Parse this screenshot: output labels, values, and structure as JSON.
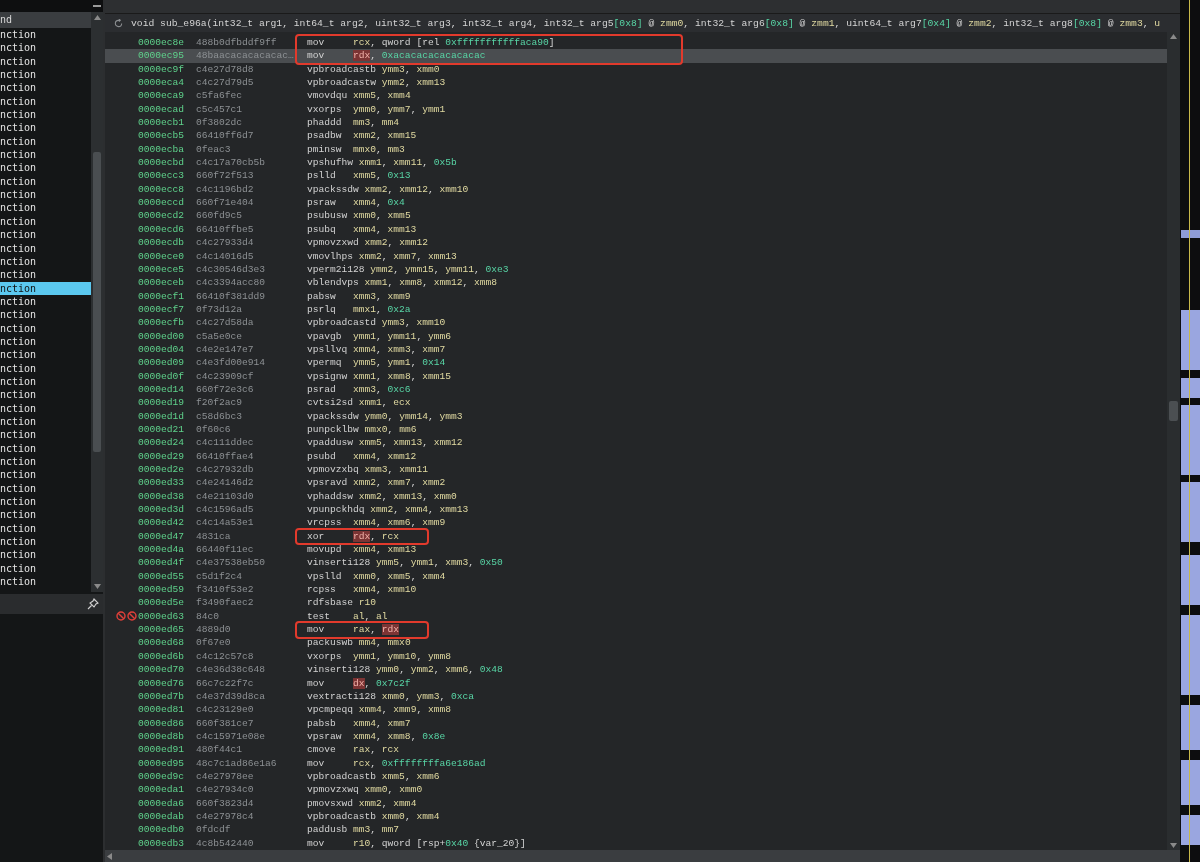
{
  "sidebar": {
    "header": "nd",
    "items": [
      {
        "label": "nction",
        "selected": false
      },
      {
        "label": "nction",
        "selected": false
      },
      {
        "label": "nction",
        "selected": false
      },
      {
        "label": "nction",
        "selected": false
      },
      {
        "label": "nction",
        "selected": false
      },
      {
        "label": "nction",
        "selected": false
      },
      {
        "label": "nction",
        "selected": false
      },
      {
        "label": "nction",
        "selected": false
      },
      {
        "label": "nction",
        "selected": false
      },
      {
        "label": "nction",
        "selected": false
      },
      {
        "label": "nction",
        "selected": false
      },
      {
        "label": "nction",
        "selected": false
      },
      {
        "label": "nction",
        "selected": false
      },
      {
        "label": "nction",
        "selected": false
      },
      {
        "label": "nction",
        "selected": false
      },
      {
        "label": "nction",
        "selected": false
      },
      {
        "label": "nction",
        "selected": false
      },
      {
        "label": "nction",
        "selected": false
      },
      {
        "label": "nction",
        "selected": false
      },
      {
        "label": "nction",
        "selected": true
      },
      {
        "label": "nction",
        "selected": false
      },
      {
        "label": "nction",
        "selected": false
      },
      {
        "label": "nction",
        "selected": false
      },
      {
        "label": "nction",
        "selected": false
      },
      {
        "label": "nction",
        "selected": false
      },
      {
        "label": "nction",
        "selected": false
      },
      {
        "label": "nction",
        "selected": false
      },
      {
        "label": "nction",
        "selected": false
      },
      {
        "label": "nction",
        "selected": false
      },
      {
        "label": "nction",
        "selected": false
      },
      {
        "label": "nction",
        "selected": false
      },
      {
        "label": "nction",
        "selected": false
      },
      {
        "label": "nction",
        "selected": false
      },
      {
        "label": "nction",
        "selected": false
      },
      {
        "label": "nction",
        "selected": false
      },
      {
        "label": "nction",
        "selected": false
      },
      {
        "label": "nction",
        "selected": false
      },
      {
        "label": "nction",
        "selected": false
      },
      {
        "label": "nction",
        "selected": false
      },
      {
        "label": "nction",
        "selected": false
      },
      {
        "label": "nction",
        "selected": false
      },
      {
        "label": "nction",
        "selected": false
      }
    ]
  },
  "signature": [
    {
      "kind": "plain",
      "text": "void sub_e96a(int32_t arg1, int64_t arg2, uint32_t arg3, int32_t arg4, int32_t arg5"
    },
    {
      "kind": "num",
      "text": "[0x8]"
    },
    {
      "kind": "plain",
      "text": " @ "
    },
    {
      "kind": "reg",
      "text": "zmm0"
    },
    {
      "kind": "plain",
      "text": ", int32_t arg6"
    },
    {
      "kind": "num",
      "text": "[0x8]"
    },
    {
      "kind": "plain",
      "text": " @ "
    },
    {
      "kind": "reg",
      "text": "zmm1"
    },
    {
      "kind": "plain",
      "text": ", uint64_t arg7"
    },
    {
      "kind": "num",
      "text": "[0x4]"
    },
    {
      "kind": "plain",
      "text": " @ "
    },
    {
      "kind": "reg",
      "text": "zmm2"
    },
    {
      "kind": "plain",
      "text": ", int32_t arg8"
    },
    {
      "kind": "num",
      "text": "[0x8]"
    },
    {
      "kind": "plain",
      "text": " @ "
    },
    {
      "kind": "reg",
      "text": "zmm3"
    },
    {
      "kind": "plain",
      "text": ", "
    },
    {
      "kind": "reg",
      "text": "u"
    }
  ],
  "rows": [
    {
      "address": "0000ec8e",
      "bytes": "488b0dfbddf9ff",
      "mnemonic": "mov",
      "ops": [
        {
          "kind": "reg",
          "text": "rcx"
        },
        {
          "kind": "plain",
          "text": ", qword [rel "
        },
        {
          "kind": "num",
          "text": "0xfffffffffffaca90"
        },
        {
          "kind": "plain",
          "text": "]"
        }
      ],
      "selected": false,
      "boxed": true,
      "breakpoint": false
    },
    {
      "address": "0000ec95",
      "bytes": "48baacacacacacac…",
      "mnemonic": "mov",
      "ops": [
        {
          "kind": "reg_hl",
          "text": "rdx"
        },
        {
          "kind": "plain",
          "text": ", "
        },
        {
          "kind": "num",
          "text": "0xacacacacacacacac"
        }
      ],
      "selected": true,
      "boxed": true,
      "breakpoint": false
    },
    {
      "address": "0000ec9f",
      "bytes": "c4e27d78d8",
      "mnemonic": "vpbroadcastb",
      "ops": [
        {
          "kind": "reg",
          "text": "ymm3"
        },
        {
          "kind": "plain",
          "text": ", "
        },
        {
          "kind": "reg",
          "text": "xmm0"
        }
      ],
      "selected": false,
      "boxed": false,
      "breakpoint": false
    },
    {
      "address": "0000eca4",
      "bytes": "c4c27d79d5",
      "mnemonic": "vpbroadcastw",
      "ops": [
        {
          "kind": "reg",
          "text": "ymm2"
        },
        {
          "kind": "plain",
          "text": ", "
        },
        {
          "kind": "reg",
          "text": "xmm13"
        }
      ],
      "selected": false,
      "boxed": false,
      "breakpoint": false
    },
    {
      "address": "0000eca9",
      "bytes": "c5fa6fec",
      "mnemonic": "vmovdqu",
      "ops": [
        {
          "kind": "reg",
          "text": "xmm5"
        },
        {
          "kind": "plain",
          "text": ", "
        },
        {
          "kind": "reg",
          "text": "xmm4"
        }
      ],
      "selected": false,
      "boxed": false,
      "breakpoint": false
    },
    {
      "address": "0000ecad",
      "bytes": "c5c457c1",
      "mnemonic": "vxorps",
      "ops": [
        {
          "kind": "reg",
          "text": "ymm0"
        },
        {
          "kind": "plain",
          "text": ", "
        },
        {
          "kind": "reg",
          "text": "ymm7"
        },
        {
          "kind": "plain",
          "text": ", "
        },
        {
          "kind": "reg",
          "text": "ymm1"
        }
      ],
      "selected": false,
      "boxed": false,
      "breakpoint": false
    },
    {
      "address": "0000ecb1",
      "bytes": "0f3802dc",
      "mnemonic": "phaddd",
      "ops": [
        {
          "kind": "reg",
          "text": "mm3"
        },
        {
          "kind": "plain",
          "text": ", "
        },
        {
          "kind": "reg",
          "text": "mm4"
        }
      ],
      "selected": false,
      "boxed": false,
      "breakpoint": false
    },
    {
      "address": "0000ecb5",
      "bytes": "66410ff6d7",
      "mnemonic": "psadbw",
      "ops": [
        {
          "kind": "reg",
          "text": "xmm2"
        },
        {
          "kind": "plain",
          "text": ", "
        },
        {
          "kind": "reg",
          "text": "xmm15"
        }
      ],
      "selected": false,
      "boxed": false,
      "breakpoint": false
    },
    {
      "address": "0000ecba",
      "bytes": "0feac3",
      "mnemonic": "pminsw",
      "ops": [
        {
          "kind": "reg",
          "text": "mmx0"
        },
        {
          "kind": "plain",
          "text": ", "
        },
        {
          "kind": "reg",
          "text": "mm3"
        }
      ],
      "selected": false,
      "boxed": false,
      "breakpoint": false
    },
    {
      "address": "0000ecbd",
      "bytes": "c4c17a70cb5b",
      "mnemonic": "vpshufhw",
      "ops": [
        {
          "kind": "reg",
          "text": "xmm1"
        },
        {
          "kind": "plain",
          "text": ", "
        },
        {
          "kind": "reg",
          "text": "xmm11"
        },
        {
          "kind": "plain",
          "text": ", "
        },
        {
          "kind": "num",
          "text": "0x5b"
        }
      ],
      "selected": false,
      "boxed": false,
      "breakpoint": false
    },
    {
      "address": "0000ecc3",
      "bytes": "660f72f513",
      "mnemonic": "pslld",
      "ops": [
        {
          "kind": "reg",
          "text": "xmm5"
        },
        {
          "kind": "plain",
          "text": ", "
        },
        {
          "kind": "num",
          "text": "0x13"
        }
      ],
      "selected": false,
      "boxed": false,
      "breakpoint": false
    },
    {
      "address": "0000ecc8",
      "bytes": "c4c1196bd2",
      "mnemonic": "vpackssdw",
      "ops": [
        {
          "kind": "reg",
          "text": "xmm2"
        },
        {
          "kind": "plain",
          "text": ", "
        },
        {
          "kind": "reg",
          "text": "xmm12"
        },
        {
          "kind": "plain",
          "text": ", "
        },
        {
          "kind": "reg",
          "text": "xmm10"
        }
      ],
      "selected": false,
      "boxed": false,
      "breakpoint": false
    },
    {
      "address": "0000eccd",
      "bytes": "660f71e404",
      "mnemonic": "psraw",
      "ops": [
        {
          "kind": "reg",
          "text": "xmm4"
        },
        {
          "kind": "plain",
          "text": ", "
        },
        {
          "kind": "num",
          "text": "0x4"
        }
      ],
      "selected": false,
      "boxed": false,
      "breakpoint": false
    },
    {
      "address": "0000ecd2",
      "bytes": "660fd9c5",
      "mnemonic": "psubusw",
      "ops": [
        {
          "kind": "reg",
          "text": "xmm0"
        },
        {
          "kind": "plain",
          "text": ", "
        },
        {
          "kind": "reg",
          "text": "xmm5"
        }
      ],
      "selected": false,
      "boxed": false,
      "breakpoint": false
    },
    {
      "address": "0000ecd6",
      "bytes": "66410ffbe5",
      "mnemonic": "psubq",
      "ops": [
        {
          "kind": "reg",
          "text": "xmm4"
        },
        {
          "kind": "plain",
          "text": ", "
        },
        {
          "kind": "reg",
          "text": "xmm13"
        }
      ],
      "selected": false,
      "boxed": false,
      "breakpoint": false
    },
    {
      "address": "0000ecdb",
      "bytes": "c4c27933d4",
      "mnemonic": "vpmovzxwd",
      "ops": [
        {
          "kind": "reg",
          "text": "xmm2"
        },
        {
          "kind": "plain",
          "text": ", "
        },
        {
          "kind": "reg",
          "text": "xmm12"
        }
      ],
      "selected": false,
      "boxed": false,
      "breakpoint": false
    },
    {
      "address": "0000ece0",
      "bytes": "c4c14016d5",
      "mnemonic": "vmovlhps",
      "ops": [
        {
          "kind": "reg",
          "text": "xmm2"
        },
        {
          "kind": "plain",
          "text": ", "
        },
        {
          "kind": "reg",
          "text": "xmm7"
        },
        {
          "kind": "plain",
          "text": ", "
        },
        {
          "kind": "reg",
          "text": "xmm13"
        }
      ],
      "selected": false,
      "boxed": false,
      "breakpoint": false
    },
    {
      "address": "0000ece5",
      "bytes": "c4c30546d3e3",
      "mnemonic": "vperm2i128",
      "ops": [
        {
          "kind": "reg",
          "text": "ymm2"
        },
        {
          "kind": "plain",
          "text": ", "
        },
        {
          "kind": "reg",
          "text": "ymm15"
        },
        {
          "kind": "plain",
          "text": ", "
        },
        {
          "kind": "reg",
          "text": "ymm11"
        },
        {
          "kind": "plain",
          "text": ", "
        },
        {
          "kind": "num",
          "text": "0xe3"
        }
      ],
      "selected": false,
      "boxed": false,
      "breakpoint": false
    },
    {
      "address": "0000eceb",
      "bytes": "c4c3394acc80",
      "mnemonic": "vblendvps",
      "ops": [
        {
          "kind": "reg",
          "text": "xmm1"
        },
        {
          "kind": "plain",
          "text": ", "
        },
        {
          "kind": "reg",
          "text": "xmm8"
        },
        {
          "kind": "plain",
          "text": ", "
        },
        {
          "kind": "reg",
          "text": "xmm12"
        },
        {
          "kind": "plain",
          "text": ", "
        },
        {
          "kind": "reg",
          "text": "xmm8"
        }
      ],
      "selected": false,
      "boxed": false,
      "breakpoint": false
    },
    {
      "address": "0000ecf1",
      "bytes": "66410f381dd9",
      "mnemonic": "pabsw",
      "ops": [
        {
          "kind": "reg",
          "text": "xmm3"
        },
        {
          "kind": "plain",
          "text": ", "
        },
        {
          "kind": "reg",
          "text": "xmm9"
        }
      ],
      "selected": false,
      "boxed": false,
      "breakpoint": false
    },
    {
      "address": "0000ecf7",
      "bytes": "0f73d12a",
      "mnemonic": "psrlq",
      "ops": [
        {
          "kind": "reg",
          "text": "mmx1"
        },
        {
          "kind": "plain",
          "text": ", "
        },
        {
          "kind": "num",
          "text": "0x2a"
        }
      ],
      "selected": false,
      "boxed": false,
      "breakpoint": false
    },
    {
      "address": "0000ecfb",
      "bytes": "c4c27d58da",
      "mnemonic": "vpbroadcastd",
      "ops": [
        {
          "kind": "reg",
          "text": "ymm3"
        },
        {
          "kind": "plain",
          "text": ", "
        },
        {
          "kind": "reg",
          "text": "xmm10"
        }
      ],
      "selected": false,
      "boxed": false,
      "breakpoint": false
    },
    {
      "address": "0000ed00",
      "bytes": "c5a5e0ce",
      "mnemonic": "vpavgb",
      "ops": [
        {
          "kind": "reg",
          "text": "ymm1"
        },
        {
          "kind": "plain",
          "text": ", "
        },
        {
          "kind": "reg",
          "text": "ymm11"
        },
        {
          "kind": "plain",
          "text": ", "
        },
        {
          "kind": "reg",
          "text": "ymm6"
        }
      ],
      "selected": false,
      "boxed": false,
      "breakpoint": false
    },
    {
      "address": "0000ed04",
      "bytes": "c4e2e147e7",
      "mnemonic": "vpsllvq",
      "ops": [
        {
          "kind": "reg",
          "text": "xmm4"
        },
        {
          "kind": "plain",
          "text": ", "
        },
        {
          "kind": "reg",
          "text": "xmm3"
        },
        {
          "kind": "plain",
          "text": ", "
        },
        {
          "kind": "reg",
          "text": "xmm7"
        }
      ],
      "selected": false,
      "boxed": false,
      "breakpoint": false
    },
    {
      "address": "0000ed09",
      "bytes": "c4e3fd00e914",
      "mnemonic": "vpermq",
      "ops": [
        {
          "kind": "reg",
          "text": "ymm5"
        },
        {
          "kind": "plain",
          "text": ", "
        },
        {
          "kind": "reg",
          "text": "ymm1"
        },
        {
          "kind": "plain",
          "text": ", "
        },
        {
          "kind": "num",
          "text": "0x14"
        }
      ],
      "selected": false,
      "boxed": false,
      "breakpoint": false
    },
    {
      "address": "0000ed0f",
      "bytes": "c4c23909cf",
      "mnemonic": "vpsignw",
      "ops": [
        {
          "kind": "reg",
          "text": "xmm1"
        },
        {
          "kind": "plain",
          "text": ", "
        },
        {
          "kind": "reg",
          "text": "xmm8"
        },
        {
          "kind": "plain",
          "text": ", "
        },
        {
          "kind": "reg",
          "text": "xmm15"
        }
      ],
      "selected": false,
      "boxed": false,
      "breakpoint": false
    },
    {
      "address": "0000ed14",
      "bytes": "660f72e3c6",
      "mnemonic": "psrad",
      "ops": [
        {
          "kind": "reg",
          "text": "xmm3"
        },
        {
          "kind": "plain",
          "text": ", "
        },
        {
          "kind": "num",
          "text": "0xc6"
        }
      ],
      "selected": false,
      "boxed": false,
      "breakpoint": false
    },
    {
      "address": "0000ed19",
      "bytes": "f20f2ac9",
      "mnemonic": "cvtsi2sd",
      "ops": [
        {
          "kind": "reg",
          "text": "xmm1"
        },
        {
          "kind": "plain",
          "text": ", "
        },
        {
          "kind": "reg",
          "text": "ecx"
        }
      ],
      "selected": false,
      "boxed": false,
      "breakpoint": false
    },
    {
      "address": "0000ed1d",
      "bytes": "c58d6bc3",
      "mnemonic": "vpackssdw",
      "ops": [
        {
          "kind": "reg",
          "text": "ymm0"
        },
        {
          "kind": "plain",
          "text": ", "
        },
        {
          "kind": "reg",
          "text": "ymm14"
        },
        {
          "kind": "plain",
          "text": ", "
        },
        {
          "kind": "reg",
          "text": "ymm3"
        }
      ],
      "selected": false,
      "boxed": false,
      "breakpoint": false
    },
    {
      "address": "0000ed21",
      "bytes": "0f60c6",
      "mnemonic": "punpcklbw",
      "ops": [
        {
          "kind": "reg",
          "text": "mmx0"
        },
        {
          "kind": "plain",
          "text": ", "
        },
        {
          "kind": "reg",
          "text": "mm6"
        }
      ],
      "selected": false,
      "boxed": false,
      "breakpoint": false
    },
    {
      "address": "0000ed24",
      "bytes": "c4c111ddec",
      "mnemonic": "vpaddusw",
      "ops": [
        {
          "kind": "reg",
          "text": "xmm5"
        },
        {
          "kind": "plain",
          "text": ", "
        },
        {
          "kind": "reg",
          "text": "xmm13"
        },
        {
          "kind": "plain",
          "text": ", "
        },
        {
          "kind": "reg",
          "text": "xmm12"
        }
      ],
      "selected": false,
      "boxed": false,
      "breakpoint": false
    },
    {
      "address": "0000ed29",
      "bytes": "66410ffae4",
      "mnemonic": "psubd",
      "ops": [
        {
          "kind": "reg",
          "text": "xmm4"
        },
        {
          "kind": "plain",
          "text": ", "
        },
        {
          "kind": "reg",
          "text": "xmm12"
        }
      ],
      "selected": false,
      "boxed": false,
      "breakpoint": false
    },
    {
      "address": "0000ed2e",
      "bytes": "c4c27932db",
      "mnemonic": "vpmovzxbq",
      "ops": [
        {
          "kind": "reg",
          "text": "xmm3"
        },
        {
          "kind": "plain",
          "text": ", "
        },
        {
          "kind": "reg",
          "text": "xmm11"
        }
      ],
      "selected": false,
      "boxed": false,
      "breakpoint": false
    },
    {
      "address": "0000ed33",
      "bytes": "c4e24146d2",
      "mnemonic": "vpsravd",
      "ops": [
        {
          "kind": "reg",
          "text": "xmm2"
        },
        {
          "kind": "plain",
          "text": ", "
        },
        {
          "kind": "reg",
          "text": "xmm7"
        },
        {
          "kind": "plain",
          "text": ", "
        },
        {
          "kind": "reg",
          "text": "xmm2"
        }
      ],
      "selected": false,
      "boxed": false,
      "breakpoint": false
    },
    {
      "address": "0000ed38",
      "bytes": "c4e21103d0",
      "mnemonic": "vphaddsw",
      "ops": [
        {
          "kind": "reg",
          "text": "xmm2"
        },
        {
          "kind": "plain",
          "text": ", "
        },
        {
          "kind": "reg",
          "text": "xmm13"
        },
        {
          "kind": "plain",
          "text": ", "
        },
        {
          "kind": "reg",
          "text": "xmm0"
        }
      ],
      "selected": false,
      "boxed": false,
      "breakpoint": false
    },
    {
      "address": "0000ed3d",
      "bytes": "c4c1596ad5",
      "mnemonic": "vpunpckhdq",
      "ops": [
        {
          "kind": "reg",
          "text": "xmm2"
        },
        {
          "kind": "plain",
          "text": ", "
        },
        {
          "kind": "reg",
          "text": "xmm4"
        },
        {
          "kind": "plain",
          "text": ", "
        },
        {
          "kind": "reg",
          "text": "xmm13"
        }
      ],
      "selected": false,
      "boxed": false,
      "breakpoint": false
    },
    {
      "address": "0000ed42",
      "bytes": "c4c14a53e1",
      "mnemonic": "vrcpss",
      "ops": [
        {
          "kind": "reg",
          "text": "xmm4"
        },
        {
          "kind": "plain",
          "text": ", "
        },
        {
          "kind": "reg",
          "text": "xmm6"
        },
        {
          "kind": "plain",
          "text": ", "
        },
        {
          "kind": "reg",
          "text": "xmm9"
        }
      ],
      "selected": false,
      "boxed": false,
      "breakpoint": false
    },
    {
      "address": "0000ed47",
      "bytes": "4831ca",
      "mnemonic": "xor",
      "ops": [
        {
          "kind": "reg_hl",
          "text": "rdx"
        },
        {
          "kind": "plain",
          "text": ", "
        },
        {
          "kind": "reg",
          "text": "rcx"
        }
      ],
      "selected": false,
      "boxed": true,
      "breakpoint": false
    },
    {
      "address": "0000ed4a",
      "bytes": "66440f11ec",
      "mnemonic": "movupd",
      "ops": [
        {
          "kind": "reg",
          "text": "xmm4"
        },
        {
          "kind": "plain",
          "text": ", "
        },
        {
          "kind": "reg",
          "text": "xmm13"
        }
      ],
      "selected": false,
      "boxed": false,
      "breakpoint": false
    },
    {
      "address": "0000ed4f",
      "bytes": "c4e37538eb50",
      "mnemonic": "vinserti128",
      "ops": [
        {
          "kind": "reg",
          "text": "ymm5"
        },
        {
          "kind": "plain",
          "text": ", "
        },
        {
          "kind": "reg",
          "text": "ymm1"
        },
        {
          "kind": "plain",
          "text": ", "
        },
        {
          "kind": "reg",
          "text": "xmm3"
        },
        {
          "kind": "plain",
          "text": ", "
        },
        {
          "kind": "num",
          "text": "0x50"
        }
      ],
      "selected": false,
      "boxed": false,
      "breakpoint": false
    },
    {
      "address": "0000ed55",
      "bytes": "c5d1f2c4",
      "mnemonic": "vpslld",
      "ops": [
        {
          "kind": "reg",
          "text": "xmm0"
        },
        {
          "kind": "plain",
          "text": ", "
        },
        {
          "kind": "reg",
          "text": "xmm5"
        },
        {
          "kind": "plain",
          "text": ", "
        },
        {
          "kind": "reg",
          "text": "xmm4"
        }
      ],
      "selected": false,
      "boxed": false,
      "breakpoint": false
    },
    {
      "address": "0000ed59",
      "bytes": "f3410f53e2",
      "mnemonic": "rcpss",
      "ops": [
        {
          "kind": "reg",
          "text": "xmm4"
        },
        {
          "kind": "plain",
          "text": ", "
        },
        {
          "kind": "reg",
          "text": "xmm10"
        }
      ],
      "selected": false,
      "boxed": false,
      "breakpoint": false
    },
    {
      "address": "0000ed5e",
      "bytes": "f3490faec2",
      "mnemonic": "rdfsbase",
      "ops": [
        {
          "kind": "reg",
          "text": "r10"
        }
      ],
      "selected": false,
      "boxed": false,
      "breakpoint": false
    },
    {
      "address": "0000ed63",
      "bytes": "84c0",
      "mnemonic": "test",
      "ops": [
        {
          "kind": "reg",
          "text": "al"
        },
        {
          "kind": "plain",
          "text": ", "
        },
        {
          "kind": "reg",
          "text": "al"
        }
      ],
      "selected": false,
      "boxed": false,
      "breakpoint": true
    },
    {
      "address": "0000ed65",
      "bytes": "4889d0",
      "mnemonic": "mov",
      "ops": [
        {
          "kind": "reg",
          "text": "rax"
        },
        {
          "kind": "plain",
          "text": ", "
        },
        {
          "kind": "reg_hl",
          "text": "rdx"
        }
      ],
      "selected": false,
      "boxed": true,
      "breakpoint": false
    },
    {
      "address": "0000ed68",
      "bytes": "0f67e0",
      "mnemonic": "packuswb",
      "ops": [
        {
          "kind": "reg",
          "text": "mm4"
        },
        {
          "kind": "plain",
          "text": ", "
        },
        {
          "kind": "reg",
          "text": "mmx0"
        }
      ],
      "selected": false,
      "boxed": false,
      "breakpoint": false
    },
    {
      "address": "0000ed6b",
      "bytes": "c4c12c57c8",
      "mnemonic": "vxorps",
      "ops": [
        {
          "kind": "reg",
          "text": "ymm1"
        },
        {
          "kind": "plain",
          "text": ", "
        },
        {
          "kind": "reg",
          "text": "ymm10"
        },
        {
          "kind": "plain",
          "text": ", "
        },
        {
          "kind": "reg",
          "text": "ymm8"
        }
      ],
      "selected": false,
      "boxed": false,
      "breakpoint": false
    },
    {
      "address": "0000ed70",
      "bytes": "c4e36d38c648",
      "mnemonic": "vinserti128",
      "ops": [
        {
          "kind": "reg",
          "text": "ymm0"
        },
        {
          "kind": "plain",
          "text": ", "
        },
        {
          "kind": "reg",
          "text": "ymm2"
        },
        {
          "kind": "plain",
          "text": ", "
        },
        {
          "kind": "reg",
          "text": "xmm6"
        },
        {
          "kind": "plain",
          "text": ", "
        },
        {
          "kind": "num",
          "text": "0x48"
        }
      ],
      "selected": false,
      "boxed": false,
      "breakpoint": false
    },
    {
      "address": "0000ed76",
      "bytes": "66c7c22f7c",
      "mnemonic": "mov",
      "ops": [
        {
          "kind": "reg_hl",
          "text": "dx"
        },
        {
          "kind": "plain",
          "text": ", "
        },
        {
          "kind": "num",
          "text": "0x7c2f"
        }
      ],
      "selected": false,
      "boxed": false,
      "breakpoint": false
    },
    {
      "address": "0000ed7b",
      "bytes": "c4e37d39d8ca",
      "mnemonic": "vextracti128",
      "ops": [
        {
          "kind": "reg",
          "text": "xmm0"
        },
        {
          "kind": "plain",
          "text": ", "
        },
        {
          "kind": "reg",
          "text": "ymm3"
        },
        {
          "kind": "plain",
          "text": ", "
        },
        {
          "kind": "num",
          "text": "0xca"
        }
      ],
      "selected": false,
      "boxed": false,
      "breakpoint": false
    },
    {
      "address": "0000ed81",
      "bytes": "c4c23129e0",
      "mnemonic": "vpcmpeqq",
      "ops": [
        {
          "kind": "reg",
          "text": "xmm4"
        },
        {
          "kind": "plain",
          "text": ", "
        },
        {
          "kind": "reg",
          "text": "xmm9"
        },
        {
          "kind": "plain",
          "text": ", "
        },
        {
          "kind": "reg",
          "text": "xmm8"
        }
      ],
      "selected": false,
      "boxed": false,
      "breakpoint": false
    },
    {
      "address": "0000ed86",
      "bytes": "660f381ce7",
      "mnemonic": "pabsb",
      "ops": [
        {
          "kind": "reg",
          "text": "xmm4"
        },
        {
          "kind": "plain",
          "text": ", "
        },
        {
          "kind": "reg",
          "text": "xmm7"
        }
      ],
      "selected": false,
      "boxed": false,
      "breakpoint": false
    },
    {
      "address": "0000ed8b",
      "bytes": "c4c15971e08e",
      "mnemonic": "vpsraw",
      "ops": [
        {
          "kind": "reg",
          "text": "xmm4"
        },
        {
          "kind": "plain",
          "text": ", "
        },
        {
          "kind": "reg",
          "text": "xmm8"
        },
        {
          "kind": "plain",
          "text": ", "
        },
        {
          "kind": "num",
          "text": "0x8e"
        }
      ],
      "selected": false,
      "boxed": false,
      "breakpoint": false
    },
    {
      "address": "0000ed91",
      "bytes": "480f44c1",
      "mnemonic": "cmove",
      "ops": [
        {
          "kind": "reg",
          "text": "rax"
        },
        {
          "kind": "plain",
          "text": ", "
        },
        {
          "kind": "reg",
          "text": "rcx"
        }
      ],
      "selected": false,
      "boxed": false,
      "breakpoint": false
    },
    {
      "address": "0000ed95",
      "bytes": "48c7c1ad86e1a6",
      "mnemonic": "mov",
      "ops": [
        {
          "kind": "reg",
          "text": "rcx"
        },
        {
          "kind": "plain",
          "text": ", "
        },
        {
          "kind": "num",
          "text": "0xffffffffa6e186ad"
        }
      ],
      "selected": false,
      "boxed": false,
      "breakpoint": false
    },
    {
      "address": "0000ed9c",
      "bytes": "c4e27978ee",
      "mnemonic": "vpbroadcastb",
      "ops": [
        {
          "kind": "reg",
          "text": "xmm5"
        },
        {
          "kind": "plain",
          "text": ", "
        },
        {
          "kind": "reg",
          "text": "xmm6"
        }
      ],
      "selected": false,
      "boxed": false,
      "breakpoint": false
    },
    {
      "address": "0000eda1",
      "bytes": "c4e27934c0",
      "mnemonic": "vpmovzxwq",
      "ops": [
        {
          "kind": "reg",
          "text": "xmm0"
        },
        {
          "kind": "plain",
          "text": ", "
        },
        {
          "kind": "reg",
          "text": "xmm0"
        }
      ],
      "selected": false,
      "boxed": false,
      "breakpoint": false
    },
    {
      "address": "0000eda6",
      "bytes": "660f3823d4",
      "mnemonic": "pmovsxwd",
      "ops": [
        {
          "kind": "reg",
          "text": "xmm2"
        },
        {
          "kind": "plain",
          "text": ", "
        },
        {
          "kind": "reg",
          "text": "xmm4"
        }
      ],
      "selected": false,
      "boxed": false,
      "breakpoint": false
    },
    {
      "address": "0000edab",
      "bytes": "c4e27978c4",
      "mnemonic": "vpbroadcastb",
      "ops": [
        {
          "kind": "reg",
          "text": "xmm0"
        },
        {
          "kind": "plain",
          "text": ", "
        },
        {
          "kind": "reg",
          "text": "xmm4"
        }
      ],
      "selected": false,
      "boxed": false,
      "breakpoint": false
    },
    {
      "address": "0000edb0",
      "bytes": "0fdcdf",
      "mnemonic": "paddusb",
      "ops": [
        {
          "kind": "reg",
          "text": "mm3"
        },
        {
          "kind": "plain",
          "text": ", "
        },
        {
          "kind": "reg",
          "text": "mm7"
        }
      ],
      "selected": false,
      "boxed": false,
      "breakpoint": false
    },
    {
      "address": "0000edb3",
      "bytes": "4c8b542440",
      "mnemonic": "mov",
      "ops": [
        {
          "kind": "reg",
          "text": "r10"
        },
        {
          "kind": "plain",
          "text": ", qword [rsp+"
        },
        {
          "kind": "num",
          "text": "0x40"
        },
        {
          "kind": "plain",
          "text": " {var_20}]"
        }
      ],
      "selected": false,
      "boxed": false,
      "breakpoint": false
    }
  ]
}
